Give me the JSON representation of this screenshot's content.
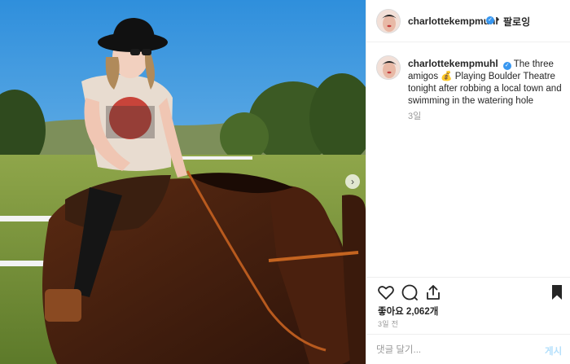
{
  "post": {
    "username": "charlottekempmuhl",
    "follow_label": "팔로잉",
    "caption_text": "The three amigos 💰 Playing Boulder Theatre tonight after robbing a local town and swimming in the watering hole",
    "caption_time": "3일",
    "likes_label": "좋아요 2,062개",
    "date_label": "3일 전"
  },
  "comment_box": {
    "placeholder": "댓글 달기...",
    "post_label": "게시"
  },
  "icons": {
    "verified": "verified-badge-icon",
    "like": "heart-icon",
    "comment": "comment-bubble-icon",
    "share": "share-icon",
    "save": "bookmark-icon",
    "next": "chevron-right-icon"
  },
  "colors": {
    "verified_blue": "#3897f0",
    "muted_text": "#999999",
    "post_button_disabled": "#b2dffc"
  },
  "verified_glyph": "✓",
  "dot": "•",
  "next_glyph": "›"
}
